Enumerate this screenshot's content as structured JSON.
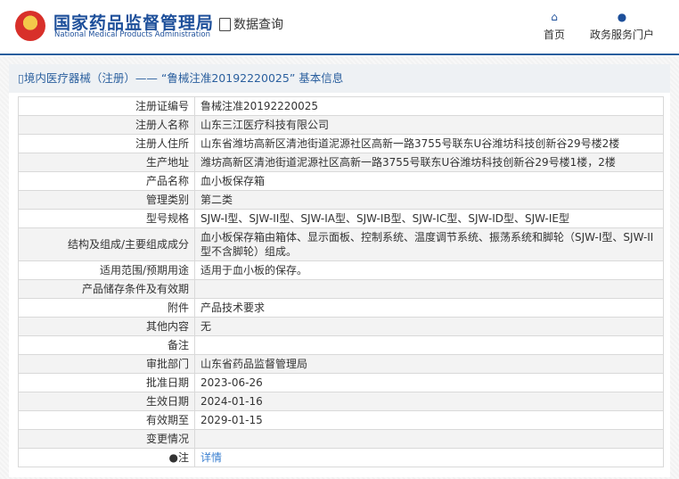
{
  "header": {
    "logo_cn": "国家药品监督管理局",
    "logo_en": "National Medical Products Administration",
    "data_query": "数据查询",
    "nav": [
      {
        "label": "首页",
        "icon": "home-icon"
      },
      {
        "label": "政务服务门户",
        "icon": "user-icon"
      }
    ]
  },
  "panel": {
    "title": "境内医疗器械（注册）—— “鲁械注准20192220025” 基本信息"
  },
  "rows": [
    {
      "label": "注册证编号",
      "value": "鲁械注准20192220025"
    },
    {
      "label": "注册人名称",
      "value": "山东三江医疗科技有限公司"
    },
    {
      "label": "注册人住所",
      "value": "山东省潍坊高新区清池街道泥源社区高新一路3755号联东U谷潍坊科技创新谷29号楼2楼"
    },
    {
      "label": "生产地址",
      "value": "潍坊高新区清池街道泥源社区高新一路3755号联东U谷潍坊科技创新谷29号楼1楼，2楼"
    },
    {
      "label": "产品名称",
      "value": "血小板保存箱"
    },
    {
      "label": "管理类别",
      "value": "第二类"
    },
    {
      "label": "型号规格",
      "value": "SJW-I型、SJW-II型、SJW-IA型、SJW-IB型、SJW-IC型、SJW-ID型、SJW-IE型"
    },
    {
      "label": "结构及组成/主要组成成分",
      "value": "血小板保存箱由箱体、显示面板、控制系统、温度调节系统、振荡系统和脚轮（SJW-I型、SJW-II型不含脚轮）组成。"
    },
    {
      "label": "适用范围/预期用途",
      "value": "适用于血小板的保存。"
    },
    {
      "label": "产品储存条件及有效期",
      "value": ""
    },
    {
      "label": "附件",
      "value": "产品技术要求"
    },
    {
      "label": "其他内容",
      "value": "无"
    },
    {
      "label": "备注",
      "value": ""
    },
    {
      "label": "审批部门",
      "value": "山东省药品监督管理局"
    },
    {
      "label": "批准日期",
      "value": "2023-06-26"
    },
    {
      "label": "生效日期",
      "value": "2024-01-16"
    },
    {
      "label": "有效期至",
      "value": "2029-01-15"
    },
    {
      "label": "变更情况",
      "value": ""
    }
  ],
  "note": {
    "label": "注",
    "link": "详情"
  }
}
